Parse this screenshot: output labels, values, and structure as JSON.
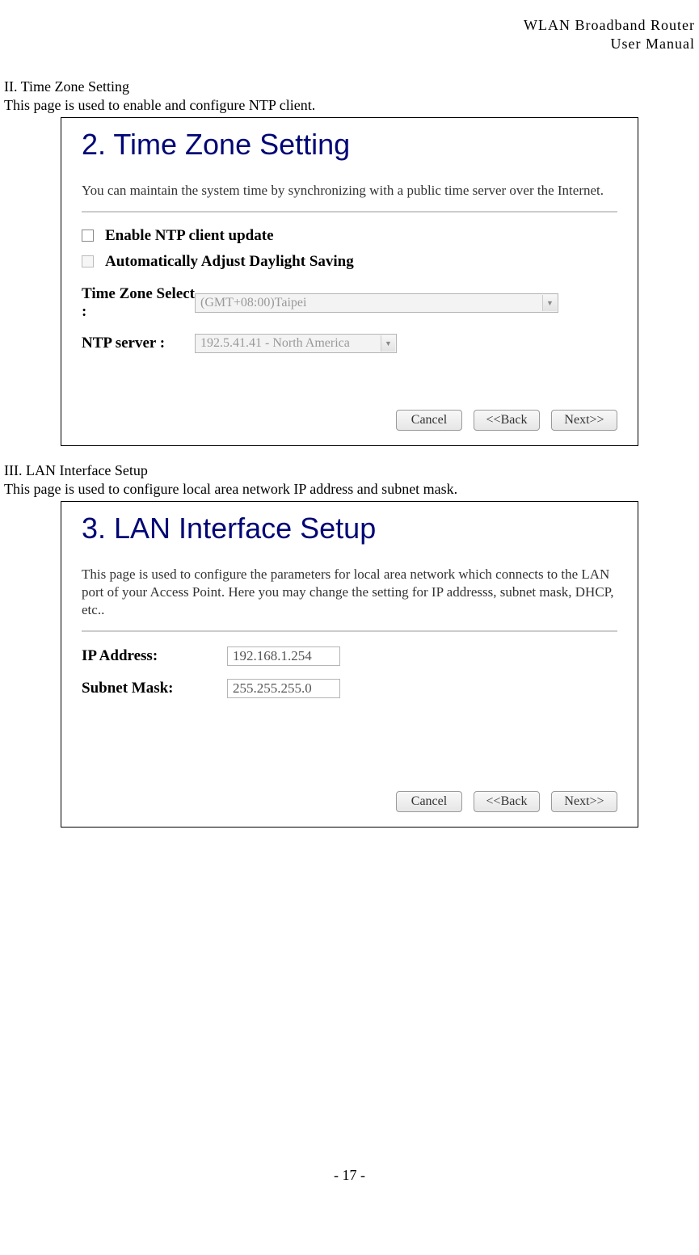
{
  "docHeader": {
    "line1": "WLAN  Broadband  Router",
    "line2": "User  Manual"
  },
  "section1": {
    "heading": "II. Time Zone Setting",
    "desc": "This page is used to enable and configure NTP client."
  },
  "panel1": {
    "title": "2. Time Zone Setting",
    "desc": "You can maintain the system time by synchronizing with a public time server over the Internet.",
    "chk1": "Enable NTP client update",
    "chk2": "Automatically Adjust Daylight Saving",
    "tzLabel": "Time Zone Select :",
    "tzValue": "(GMT+08:00)Taipei",
    "ntpLabel": "NTP server :",
    "ntpValue": "192.5.41.41 - North America",
    "btnCancel": "Cancel",
    "btnBack": "<<Back",
    "btnNext": "Next>>"
  },
  "section2": {
    "heading": "III. LAN Interface Setup",
    "desc": "This page is used to configure local area network IP address and subnet mask."
  },
  "panel2": {
    "title": "3. LAN Interface Setup",
    "desc": "This page is used to configure the parameters for local area network which connects to the LAN port of your Access Point. Here you may change the setting for IP addresss, subnet mask, DHCP, etc..",
    "ipLabel": "IP Address:",
    "ipValue": "192.168.1.254",
    "maskLabel": "Subnet Mask:",
    "maskValue": "255.255.255.0",
    "btnCancel": "Cancel",
    "btnBack": "<<Back",
    "btnNext": "Next>>"
  },
  "footer": "- 17 -"
}
